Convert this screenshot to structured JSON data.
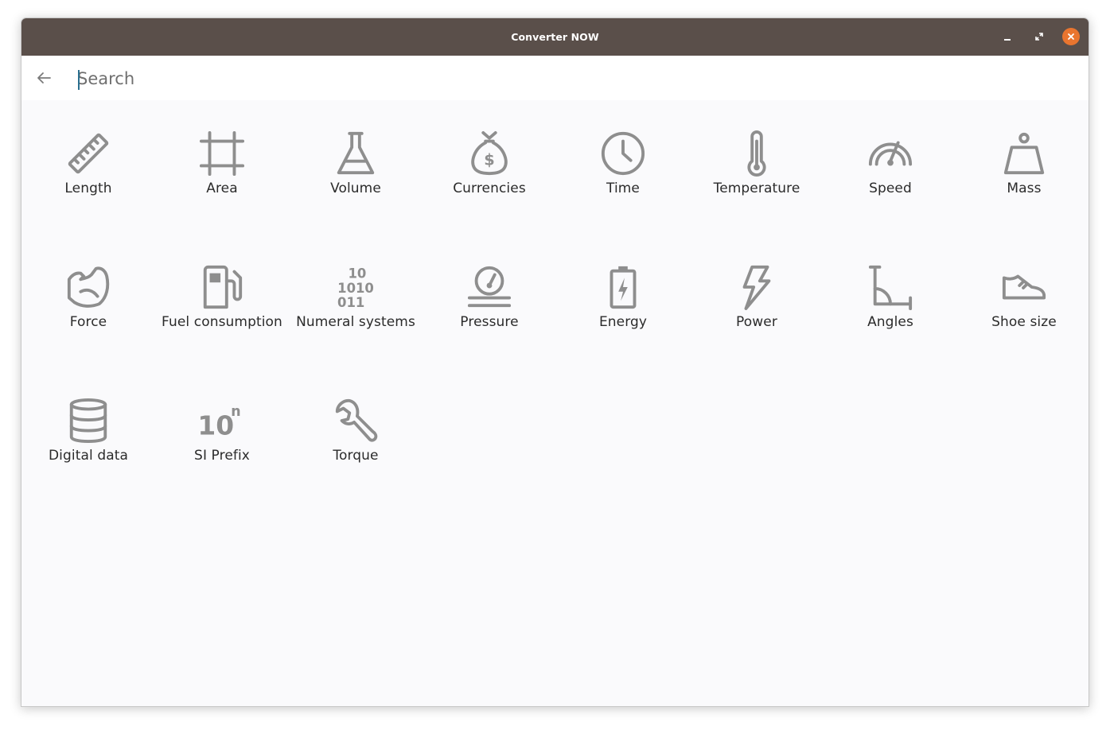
{
  "window": {
    "title": "Converter NOW",
    "accent": "#e9752f",
    "titlebar_color": "#5a4f4a"
  },
  "search": {
    "placeholder": "Search",
    "value": ""
  },
  "categories": [
    {
      "label": "Length",
      "icon": "ruler-icon"
    },
    {
      "label": "Area",
      "icon": "crop-square-icon"
    },
    {
      "label": "Volume",
      "icon": "flask-icon"
    },
    {
      "label": "Currencies",
      "icon": "money-bag-icon"
    },
    {
      "label": "Time",
      "icon": "clock-icon"
    },
    {
      "label": "Temperature",
      "icon": "thermometer-icon"
    },
    {
      "label": "Speed",
      "icon": "speedometer-icon"
    },
    {
      "label": "Mass",
      "icon": "weight-icon"
    },
    {
      "label": "Force",
      "icon": "arm-flex-icon"
    },
    {
      "label": "Fuel consumption",
      "icon": "fuel-pump-icon"
    },
    {
      "label": "Numeral systems",
      "icon": "binary-icon"
    },
    {
      "label": "Pressure",
      "icon": "gauge-icon"
    },
    {
      "label": "Energy",
      "icon": "battery-charging-icon"
    },
    {
      "label": "Power",
      "icon": "lightning-icon"
    },
    {
      "label": "Angles",
      "icon": "angle-icon"
    },
    {
      "label": "Shoe size",
      "icon": "shoe-icon"
    },
    {
      "label": "Digital data",
      "icon": "database-icon"
    },
    {
      "label": "SI Prefix",
      "icon": "power-of-ten-icon"
    },
    {
      "label": "Torque",
      "icon": "wrench-icon"
    }
  ],
  "icon_text": {
    "binary_1": "10",
    "binary_2": "1010",
    "binary_3": "011",
    "power_base": "10",
    "power_exp": "n"
  }
}
